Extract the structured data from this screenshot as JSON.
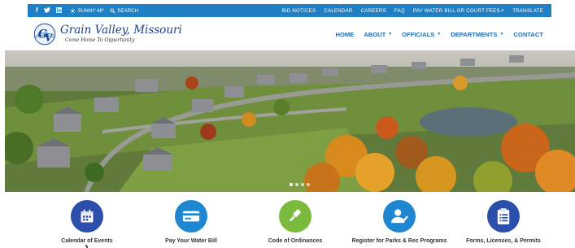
{
  "topbar": {
    "social": [
      "f",
      "✉",
      "in"
    ],
    "weather": "SUNNY 48°",
    "search": "SEARCH",
    "links": [
      "BID NOTICES",
      "CALENDAR",
      "CAREERS",
      "FAQ",
      "PAY WATER BILL OR COURT FEES↗",
      "TRANSLATE"
    ]
  },
  "header": {
    "logo_name": "Grain Valley, Missouri",
    "logo_tagline": "Come Home To Opportunity",
    "logo_letters": "GV",
    "nav": [
      {
        "label": "HOME",
        "dropdown": false
      },
      {
        "label": "ABOUT",
        "dropdown": true
      },
      {
        "label": "OFFICIALS",
        "dropdown": true
      },
      {
        "label": "DEPARTMENTS",
        "dropdown": true
      },
      {
        "label": "CONTACT",
        "dropdown": false
      }
    ]
  },
  "hero": {
    "slides": 4,
    "active_slide": 1
  },
  "quick_links": [
    {
      "label": "Calendar of Events",
      "icon": "calendar-icon",
      "color": "#2b4faa"
    },
    {
      "label": "Pay Your Water Bill",
      "icon": "credit-card-icon",
      "color": "#1f87d2"
    },
    {
      "label": "Code of Ordinances",
      "icon": "gavel-icon",
      "color": "#7cba3d"
    },
    {
      "label": "Register for Parks & Rec Programs",
      "icon": "user-check-icon",
      "color": "#1f87d2"
    },
    {
      "label": "Forms, Licenses, & Permits",
      "icon": "clipboard-icon",
      "color": "#2b4faa"
    }
  ],
  "colors": {
    "topbar": "#1f7fc4",
    "nav": "#1f6fb8",
    "logo": "#1c3e8c"
  }
}
